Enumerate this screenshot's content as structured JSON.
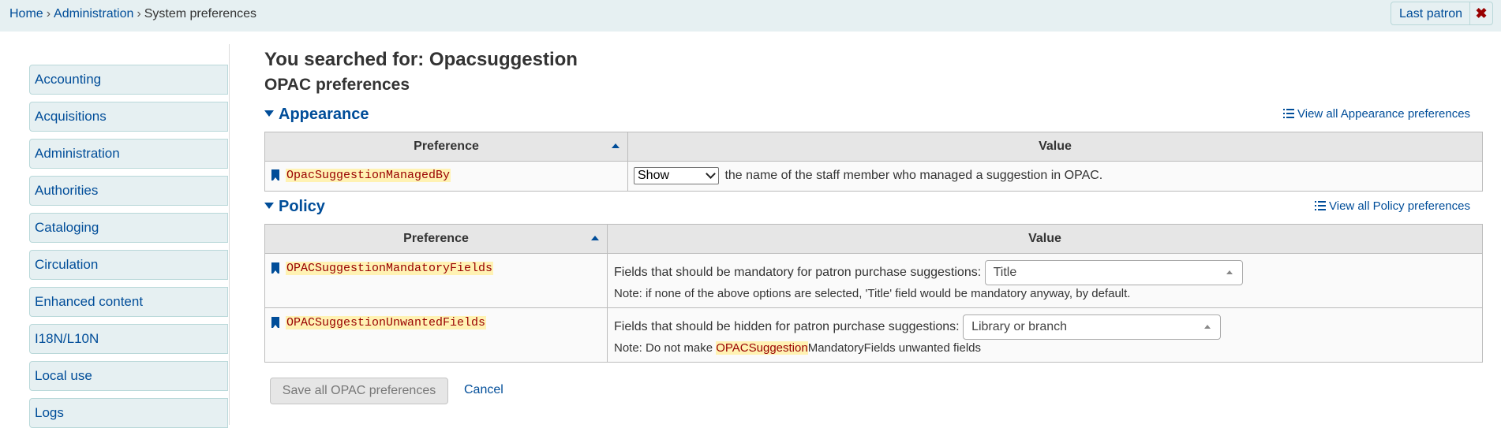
{
  "breadcrumb": {
    "home": "Home",
    "sep": "›",
    "admin": "Administration",
    "current": "System preferences"
  },
  "header": {
    "last_patron": "Last patron",
    "close": "✖"
  },
  "sidebar": {
    "items": [
      {
        "label": "Accounting"
      },
      {
        "label": "Acquisitions"
      },
      {
        "label": "Administration"
      },
      {
        "label": "Authorities"
      },
      {
        "label": "Cataloging"
      },
      {
        "label": "Circulation"
      },
      {
        "label": "Enhanced content"
      },
      {
        "label": "I18N/L10N"
      },
      {
        "label": "Local use"
      },
      {
        "label": "Logs"
      }
    ]
  },
  "main": {
    "search_title": "You searched for: Opacsuggestion",
    "category_title": "OPAC preferences",
    "appearance": {
      "title": "Appearance",
      "view_all": "View all Appearance preferences",
      "col_pref": "Preference",
      "col_value": "Value",
      "row": {
        "name": "OpacSuggestionManagedBy",
        "select": "Show",
        "text": "the name of the staff member who managed a suggestion in OPAC."
      }
    },
    "policy": {
      "title": "Policy",
      "view_all": "View all Policy preferences",
      "col_pref": "Preference",
      "col_value": "Value",
      "rows": [
        {
          "name": "OPACSuggestionMandatoryFields",
          "label": "Fields that should be mandatory for patron purchase suggestions:",
          "select": "Title",
          "note": "Note: if none of the above options are selected, 'Title' field would be mandatory anyway, by default."
        },
        {
          "name": "OPACSuggestionUnwantedFields",
          "label": "Fields that should be hidden for patron purchase suggestions:",
          "select": "Library or branch",
          "note_prefix": "Note: Do not make ",
          "note_hl": "OPACSuggestion",
          "note_suffix": "MandatoryFields unwanted fields"
        }
      ]
    },
    "save_button": "Save all OPAC preferences",
    "cancel": "Cancel"
  },
  "colors": {
    "link": "#004d99",
    "highlight_bg": "#fff2b3",
    "highlight_fg": "#990000",
    "topbar": "#e6f0f2"
  },
  "icons": [
    "bookmark-icon",
    "list-icon",
    "caret-down-icon",
    "sort-up-icon",
    "close-icon"
  ]
}
